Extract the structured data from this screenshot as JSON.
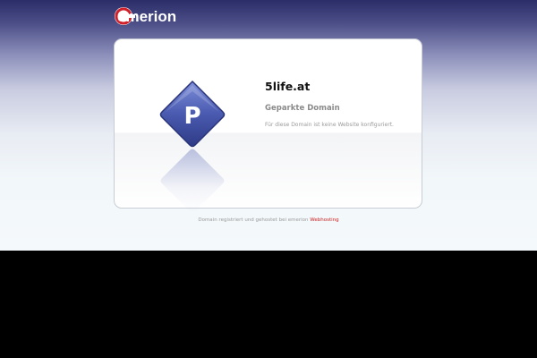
{
  "header": {
    "logo_text": "emerion",
    "logo_icon": "emerion-logo"
  },
  "card": {
    "icon": "parking-p-diamond-icon",
    "icon_letter": "P",
    "domain": "5life.at",
    "subtitle": "Geparkte Domain",
    "description": "Für diese Domain ist keine Website konfiguriert."
  },
  "footer": {
    "text": "Domain registriert und gehostet bei emerion",
    "link": "Webhosting",
    "link_color": "#cc2222"
  },
  "colors": {
    "header_dark": "#2b2d68",
    "background_bottom": "#000000",
    "logo_red": "#d0202a",
    "icon_blue": "#4a5ab0"
  }
}
